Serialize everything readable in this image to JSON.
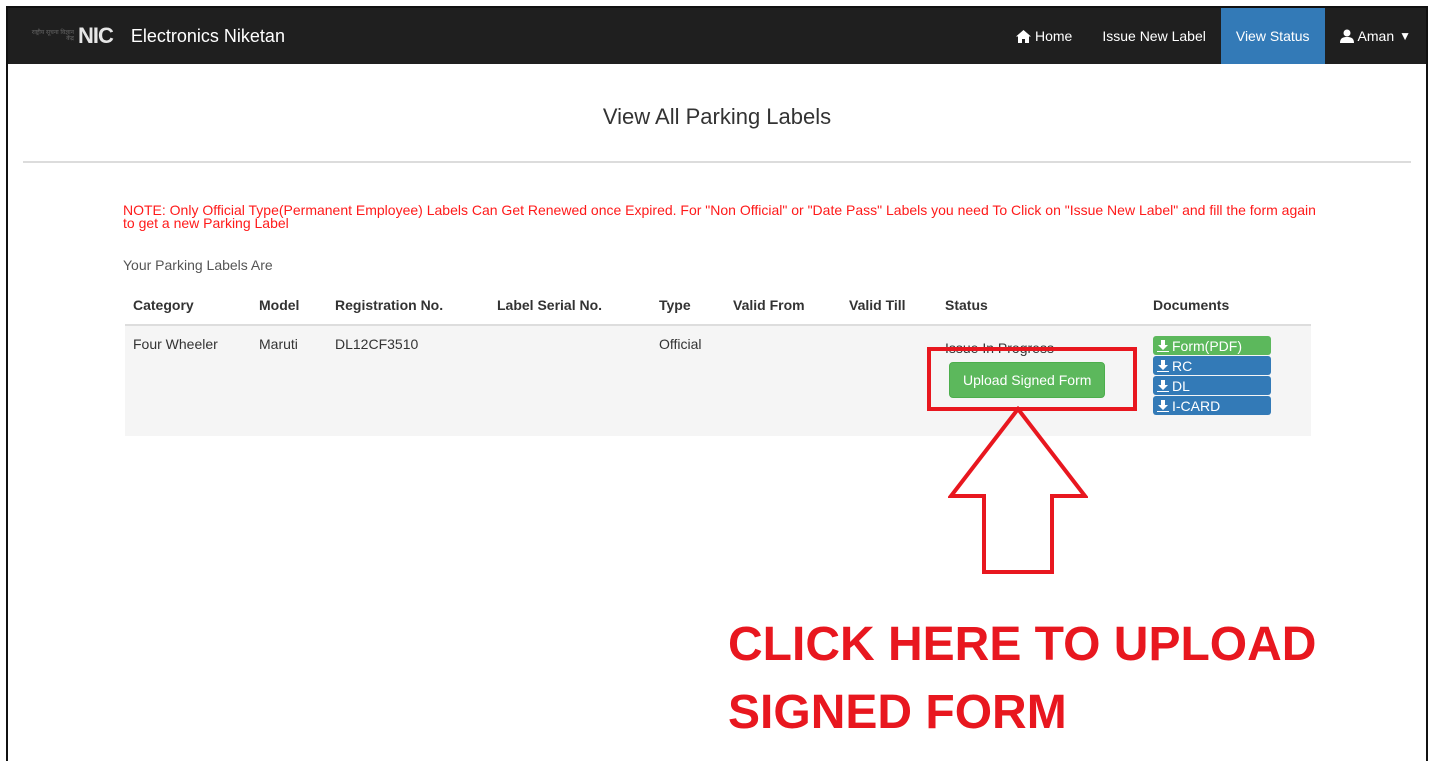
{
  "navbar": {
    "logo_small_text": "राष्ट्रीय सूचना विज्ञान केंद्र",
    "logo_text": "NIC",
    "brand": "Electronics Niketan",
    "items": [
      {
        "label": "Home",
        "icon": "home-icon"
      },
      {
        "label": "Issue New Label"
      },
      {
        "label": "View Status",
        "active": true
      },
      {
        "label": "Aman",
        "icon": "user-icon"
      }
    ]
  },
  "page": {
    "title": "View All Parking Labels",
    "note": "NOTE: Only Official Type(Permanent Employee) Labels Can Get Renewed once Expired. For \"Non Official\" or \"Date Pass\" Labels you need To Click on \"Issue New Label\" and fill the form again to get a new Parking Label",
    "subheading": "Your Parking Labels Are"
  },
  "table": {
    "headers": [
      "Category",
      "Model",
      "Registration No.",
      "Label Serial No.",
      "Type",
      "Valid From",
      "Valid Till",
      "Status",
      "Documents"
    ],
    "rows": [
      {
        "category": "Four Wheeler",
        "model": "Maruti",
        "registration": "DL12CF3510",
        "serial": "",
        "type": "Official",
        "valid_from": "",
        "valid_till": "",
        "status": "Issue In Progress",
        "action": "Upload Signed Form",
        "documents": [
          "Form(PDF)",
          "RC",
          "DL",
          "I-CARD"
        ]
      }
    ]
  },
  "annotation": {
    "line1": "CLICK HERE TO UPLOAD",
    "line2": "SIGNED FORM"
  },
  "colors": {
    "navbar": "#1f1f1f",
    "active_tab": "#337ab7",
    "success": "#5cb85c",
    "primary": "#337ab7",
    "note": "#ff1a1a",
    "annotation": "#e8171f"
  }
}
